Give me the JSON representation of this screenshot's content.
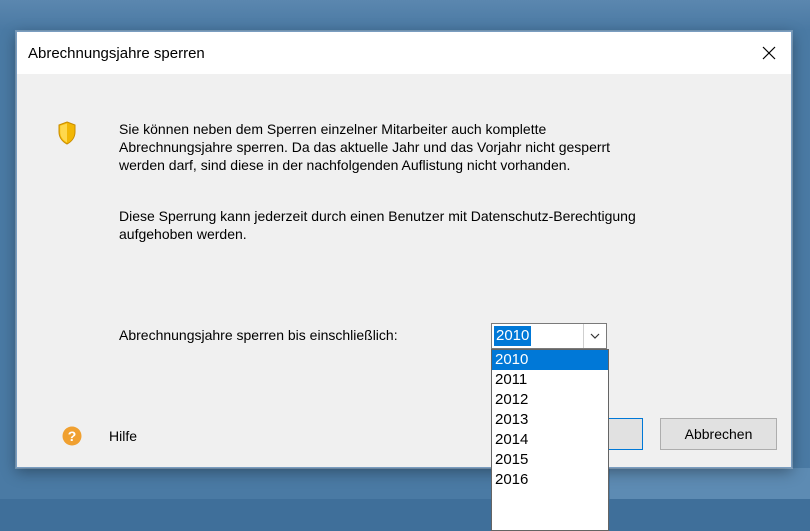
{
  "dialog": {
    "title": "Abrechnungsjahre sperren",
    "close_icon": "close-icon",
    "info_icon": "shield-icon",
    "paragraph1": "Sie können neben dem Sperren einzelner Mitarbeiter auch komplette\nAbrechnungsjahre sperren. Da das aktuelle Jahr und das Vorjahr nicht gesperrt\nwerden darf, sind diese in der nachfolgenden Auflistung nicht vorhanden.",
    "paragraph2": "Diese Sperrung kann jederzeit durch einen Benutzer mit Datenschutz-Berechtigung\naufgehoben werden.",
    "year_label": "Abrechnungsjahre sperren bis einschließlich:",
    "year_select": {
      "value": "2010",
      "options": [
        "2010",
        "2011",
        "2012",
        "2013",
        "2014",
        "2015",
        "2016"
      ],
      "selected_index": 0
    },
    "help": {
      "icon": "help-icon",
      "label": "Hilfe"
    },
    "buttons": {
      "cancel_label": "Abbrechen"
    }
  },
  "colors": {
    "accent": "#0078d7",
    "dialog_bg": "#f0f0f0",
    "titlebar_bg": "#ffffff",
    "shield": "#f2b705",
    "help": "#f0a030",
    "desktop": "#4a7aa4"
  }
}
